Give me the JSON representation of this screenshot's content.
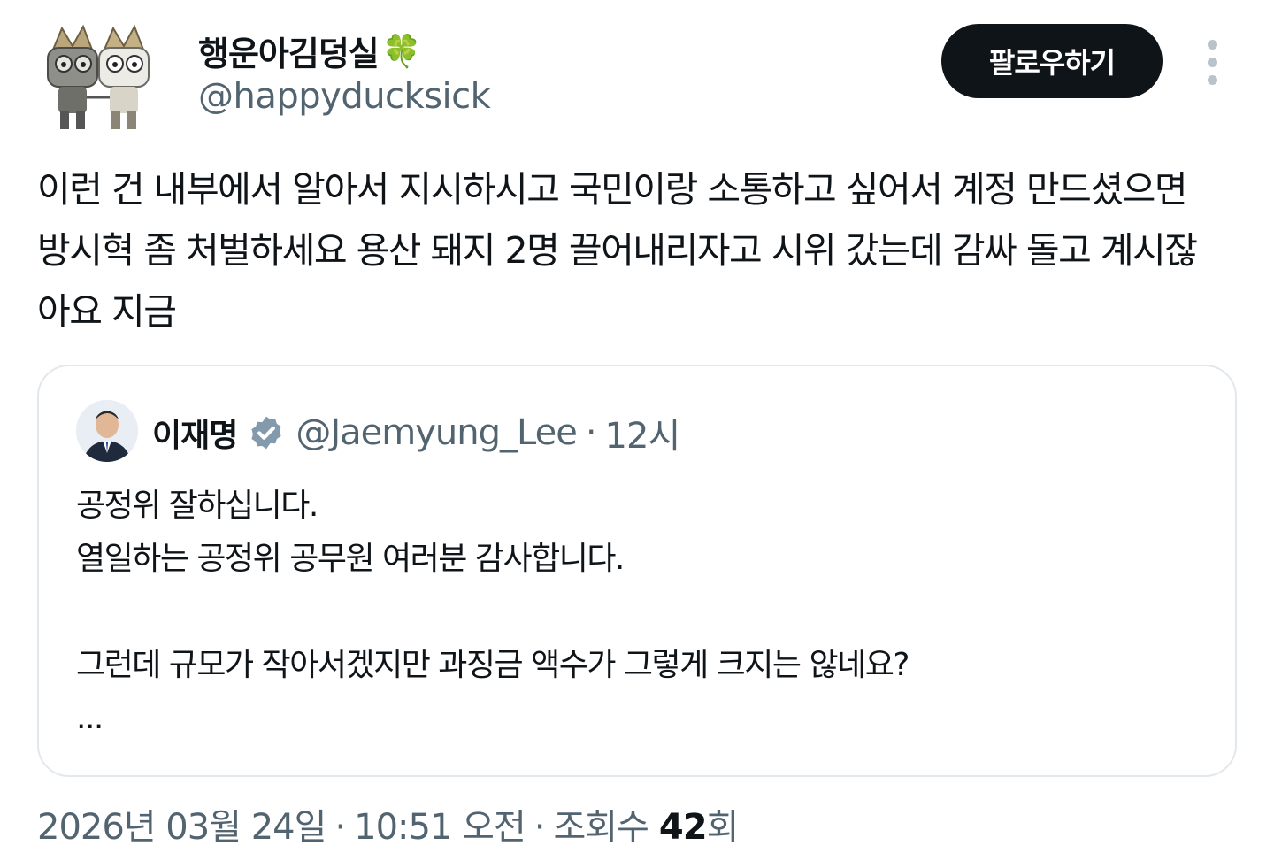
{
  "author": {
    "display_name": "행운아김덩실",
    "name_emoji": "🍀",
    "handle": "@happyducksick",
    "avatar_icon": "twin-robot-characters-avatar"
  },
  "actions": {
    "follow_label": "팔로우하기",
    "more_icon": "more-vertical-icon"
  },
  "tweet": {
    "text": "이런 건 내부에서 알아서 지시하시고 국민이랑 소통하고 싶어서 계정 만드셨으면 방시혁 좀 처벌하세요 용산 돼지 2명 끌어내리자고 시위 갔는데 감싸 돌고 계시잖아요 지금"
  },
  "quote": {
    "display_name": "이재명",
    "verified_icon": "verified-badge-icon",
    "handle": "@Jaemyung_Lee",
    "separator": "·",
    "time": "12시",
    "lines": [
      "공정위 잘하십니다.",
      "열일하는 공정위 공무원 여러분 감사합니다.",
      "",
      "그런데 규모가 작아서겠지만 과징금 액수가 그렇게 크지는 않네요?",
      "..."
    ]
  },
  "meta": {
    "date": "2026년 03월 24일",
    "separator": "·",
    "time": "10:51 오전",
    "views_label": "조회수",
    "views_count": "42",
    "views_suffix": "회"
  }
}
